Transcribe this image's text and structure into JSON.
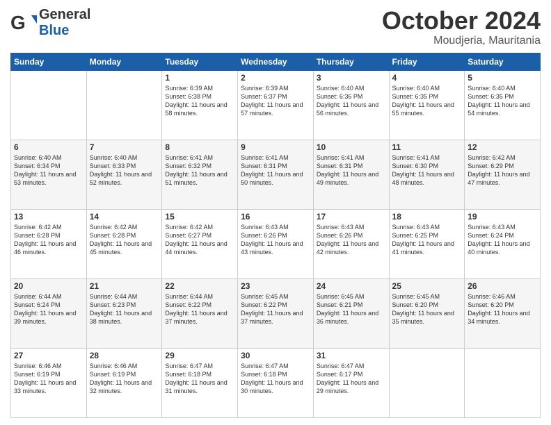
{
  "header": {
    "logo_general": "General",
    "logo_blue": "Blue",
    "month": "October 2024",
    "location": "Moudjeria, Mauritania"
  },
  "days_of_week": [
    "Sunday",
    "Monday",
    "Tuesday",
    "Wednesday",
    "Thursday",
    "Friday",
    "Saturday"
  ],
  "weeks": [
    [
      {
        "day": "",
        "info": ""
      },
      {
        "day": "",
        "info": ""
      },
      {
        "day": "1",
        "info": "Sunrise: 6:39 AM\nSunset: 6:38 PM\nDaylight: 11 hours and 58 minutes."
      },
      {
        "day": "2",
        "info": "Sunrise: 6:39 AM\nSunset: 6:37 PM\nDaylight: 11 hours and 57 minutes."
      },
      {
        "day": "3",
        "info": "Sunrise: 6:40 AM\nSunset: 6:36 PM\nDaylight: 11 hours and 56 minutes."
      },
      {
        "day": "4",
        "info": "Sunrise: 6:40 AM\nSunset: 6:35 PM\nDaylight: 11 hours and 55 minutes."
      },
      {
        "day": "5",
        "info": "Sunrise: 6:40 AM\nSunset: 6:35 PM\nDaylight: 11 hours and 54 minutes."
      }
    ],
    [
      {
        "day": "6",
        "info": "Sunrise: 6:40 AM\nSunset: 6:34 PM\nDaylight: 11 hours and 53 minutes."
      },
      {
        "day": "7",
        "info": "Sunrise: 6:40 AM\nSunset: 6:33 PM\nDaylight: 11 hours and 52 minutes."
      },
      {
        "day": "8",
        "info": "Sunrise: 6:41 AM\nSunset: 6:32 PM\nDaylight: 11 hours and 51 minutes."
      },
      {
        "day": "9",
        "info": "Sunrise: 6:41 AM\nSunset: 6:31 PM\nDaylight: 11 hours and 50 minutes."
      },
      {
        "day": "10",
        "info": "Sunrise: 6:41 AM\nSunset: 6:31 PM\nDaylight: 11 hours and 49 minutes."
      },
      {
        "day": "11",
        "info": "Sunrise: 6:41 AM\nSunset: 6:30 PM\nDaylight: 11 hours and 48 minutes."
      },
      {
        "day": "12",
        "info": "Sunrise: 6:42 AM\nSunset: 6:29 PM\nDaylight: 11 hours and 47 minutes."
      }
    ],
    [
      {
        "day": "13",
        "info": "Sunrise: 6:42 AM\nSunset: 6:28 PM\nDaylight: 11 hours and 46 minutes."
      },
      {
        "day": "14",
        "info": "Sunrise: 6:42 AM\nSunset: 6:28 PM\nDaylight: 11 hours and 45 minutes."
      },
      {
        "day": "15",
        "info": "Sunrise: 6:42 AM\nSunset: 6:27 PM\nDaylight: 11 hours and 44 minutes."
      },
      {
        "day": "16",
        "info": "Sunrise: 6:43 AM\nSunset: 6:26 PM\nDaylight: 11 hours and 43 minutes."
      },
      {
        "day": "17",
        "info": "Sunrise: 6:43 AM\nSunset: 6:26 PM\nDaylight: 11 hours and 42 minutes."
      },
      {
        "day": "18",
        "info": "Sunrise: 6:43 AM\nSunset: 6:25 PM\nDaylight: 11 hours and 41 minutes."
      },
      {
        "day": "19",
        "info": "Sunrise: 6:43 AM\nSunset: 6:24 PM\nDaylight: 11 hours and 40 minutes."
      }
    ],
    [
      {
        "day": "20",
        "info": "Sunrise: 6:44 AM\nSunset: 6:24 PM\nDaylight: 11 hours and 39 minutes."
      },
      {
        "day": "21",
        "info": "Sunrise: 6:44 AM\nSunset: 6:23 PM\nDaylight: 11 hours and 38 minutes."
      },
      {
        "day": "22",
        "info": "Sunrise: 6:44 AM\nSunset: 6:22 PM\nDaylight: 11 hours and 37 minutes."
      },
      {
        "day": "23",
        "info": "Sunrise: 6:45 AM\nSunset: 6:22 PM\nDaylight: 11 hours and 37 minutes."
      },
      {
        "day": "24",
        "info": "Sunrise: 6:45 AM\nSunset: 6:21 PM\nDaylight: 11 hours and 36 minutes."
      },
      {
        "day": "25",
        "info": "Sunrise: 6:45 AM\nSunset: 6:20 PM\nDaylight: 11 hours and 35 minutes."
      },
      {
        "day": "26",
        "info": "Sunrise: 6:46 AM\nSunset: 6:20 PM\nDaylight: 11 hours and 34 minutes."
      }
    ],
    [
      {
        "day": "27",
        "info": "Sunrise: 6:46 AM\nSunset: 6:19 PM\nDaylight: 11 hours and 33 minutes."
      },
      {
        "day": "28",
        "info": "Sunrise: 6:46 AM\nSunset: 6:19 PM\nDaylight: 11 hours and 32 minutes."
      },
      {
        "day": "29",
        "info": "Sunrise: 6:47 AM\nSunset: 6:18 PM\nDaylight: 11 hours and 31 minutes."
      },
      {
        "day": "30",
        "info": "Sunrise: 6:47 AM\nSunset: 6:18 PM\nDaylight: 11 hours and 30 minutes."
      },
      {
        "day": "31",
        "info": "Sunrise: 6:47 AM\nSunset: 6:17 PM\nDaylight: 11 hours and 29 minutes."
      },
      {
        "day": "",
        "info": ""
      },
      {
        "day": "",
        "info": ""
      }
    ]
  ]
}
